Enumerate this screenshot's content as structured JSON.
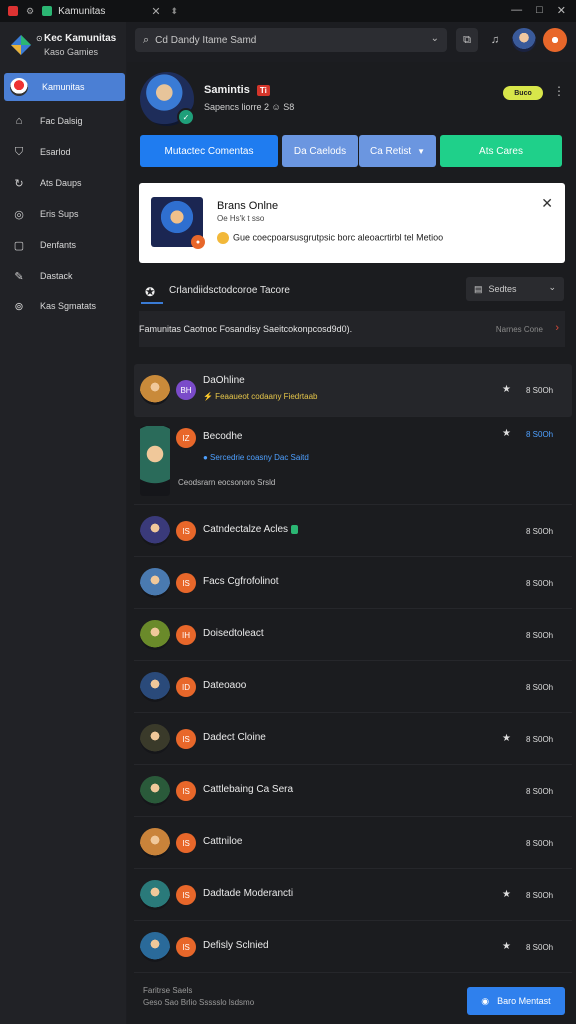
{
  "window": {
    "title": "Kamunitas",
    "controls": [
      "—",
      "□",
      "✕"
    ]
  },
  "brand": {
    "name": "Kec Kamunitas",
    "sub": "Kaso Gamies"
  },
  "sidebar": {
    "items": [
      {
        "label": "Kamunitas",
        "icon": "avatar-icon"
      },
      {
        "label": "Fac Dalsig",
        "icon": "home-icon"
      },
      {
        "label": "Esarlod",
        "icon": "shield-icon"
      },
      {
        "label": "Ats Daups",
        "icon": "refresh-icon"
      },
      {
        "label": "Eris Sups",
        "icon": "target-icon"
      },
      {
        "label": "Denfants",
        "icon": "square-icon"
      },
      {
        "label": "Dastack",
        "icon": "edit-icon"
      },
      {
        "label": "Kas Sgmatats",
        "icon": "circle-icon"
      }
    ]
  },
  "search": {
    "value": "Cd Dandy Itame Samd"
  },
  "profile": {
    "name": "Samintis",
    "tag": "Ti",
    "sub": "Sapencs liorre 2 ☺ S8",
    "status": "Buco"
  },
  "actions": {
    "primary": "Mutactec Comentas",
    "segment_left": "Da Caelods",
    "segment_right": "Ca Retist",
    "secondary": "Ats Cares"
  },
  "card": {
    "title": "Brans Onlne",
    "sub": "Oe Hs'k t sso",
    "desc": "Gue coecpoarsusgrutpsic borc aleoacrtirbl tel Metioo"
  },
  "section": {
    "title": "Crlandiidsctodcoroe Tacore",
    "sort": "Sedtes"
  },
  "notice": {
    "text": "Famunitas Caotnoc Fosandisy Saeitcokonpcosd9d0).",
    "link": "Narnes Cone"
  },
  "games": [
    {
      "title": "DaOhline",
      "sub": "Feaaueot codaany Fiedrtaab",
      "badge": "BH",
      "star": true,
      "count": "8 S0Oh",
      "sub_color": "#e6c64a",
      "highlight": true,
      "thumb_color": "#c98a3a",
      "badge_color": "#7a4bc9"
    },
    {
      "title": "Becodhe",
      "sub": "Sercedrie coasny Dac Saitd",
      "sub2": "Ceodsrarn eocsonoro Srsld",
      "badge": "IZ",
      "star": true,
      "count": "8 S0Oh",
      "sub_color": "#4ea0ff",
      "thumb_color": "#2a6b5a",
      "badge_color": "#e8672a"
    },
    {
      "title": "Catndectalze Acles",
      "badge": "IS",
      "star": false,
      "count": "8 S0Oh",
      "gem": true,
      "thumb_color": "#3a3a7a",
      "badge_color": "#e8672a"
    },
    {
      "title": "Facs Cgfrofolinot",
      "badge": "IS",
      "star": false,
      "count": "8 S0Oh",
      "thumb_color": "#4a7ab0",
      "badge_color": "#e8672a"
    },
    {
      "title": "Doisedtoleact",
      "badge": "IH",
      "star": false,
      "count": "8 S0Oh",
      "thumb_color": "#6a8a2a",
      "badge_color": "#e8672a"
    },
    {
      "title": "Dateoaoo",
      "badge": "ID",
      "star": false,
      "count": "8 S0Oh",
      "thumb_color": "#2a4a7a",
      "badge_color": "#e8672a"
    },
    {
      "title": "Dadect Cloine",
      "badge": "IS",
      "star": true,
      "count": "8 S0Oh",
      "thumb_color": "#3a3a2a",
      "badge_color": "#e8672a"
    },
    {
      "title": "Cattlebaing Ca Sera",
      "badge": "IS",
      "star": false,
      "count": "8 S0Oh",
      "thumb_color": "#2a5a3a",
      "badge_color": "#e8672a"
    },
    {
      "title": "Cattniloe",
      "badge": "IS",
      "star": false,
      "count": "8 S0Oh",
      "thumb_color": "#c9833a",
      "badge_color": "#e8672a"
    },
    {
      "title": "Dadtade Moderancti",
      "badge": "IS",
      "star": true,
      "count": "8 S0Oh",
      "thumb_color": "#2a7a7a",
      "badge_color": "#e8672a"
    },
    {
      "title": "Defisly Sclnied",
      "badge": "IS",
      "star": true,
      "count": "8 S0Oh",
      "thumb_color": "#2a6a9a",
      "badge_color": "#e8672a"
    }
  ],
  "footer": {
    "line1": "Faritrse Saels",
    "line2": "Geso Sao Brlio Ssssslo lsdsmo",
    "button": "Baro Mentast"
  },
  "colors": {
    "accent": "#3a7bd5",
    "primary_btn": "#1f7cf0",
    "segment": "#6b96e0",
    "secondary_btn": "#1fd08a",
    "card_bg": "#ffffff"
  }
}
